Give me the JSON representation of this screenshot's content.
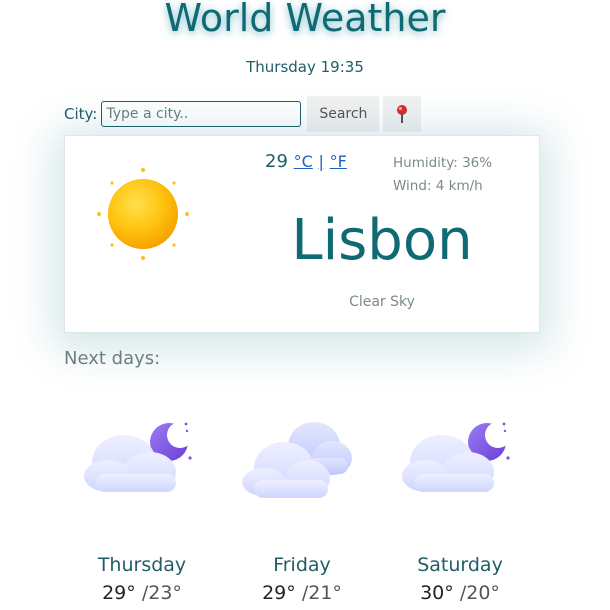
{
  "app": {
    "title": "World Weather",
    "datetime": "Thursday 19:35"
  },
  "search": {
    "label": "City:",
    "placeholder": "Type a city..",
    "value": "",
    "button_label": "Search",
    "location_icon": "map-pin-icon"
  },
  "current": {
    "temperature": "29",
    "unit_celsius": "°C",
    "unit_separator": "|",
    "unit_fahrenheit": "°F",
    "humidity": "Humidity: 36%",
    "wind": "Wind: 4 km/h",
    "city": "Lisbon",
    "description": "Clear Sky",
    "icon": "sun-icon"
  },
  "forecast": {
    "label": "Next days:",
    "days": [
      {
        "name": "Thursday",
        "high": "29°",
        "low": "/23°",
        "icon": "cloud-moon-icon"
      },
      {
        "name": "Friday",
        "high": "29°",
        "low": "/21°",
        "icon": "clouds-icon"
      },
      {
        "name": "Saturday",
        "high": "30°",
        "low": "/20°",
        "icon": "cloud-moon-icon"
      }
    ]
  },
  "colors": {
    "accent": "#0f6a73",
    "link": "#1a62c4",
    "muted": "#7b8a8c"
  }
}
